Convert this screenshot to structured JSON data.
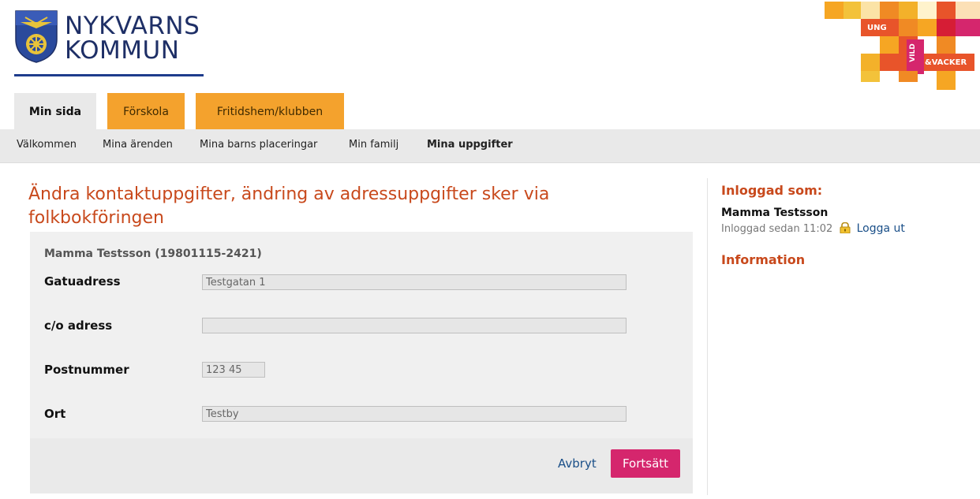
{
  "logo": {
    "line1": "NYKVARNS",
    "line2": "KOMMUN"
  },
  "brand": {
    "ung": "UNG",
    "vild": "VILD",
    "vacker": "&VACKER"
  },
  "tabs": [
    {
      "label": "Min sida"
    },
    {
      "label": "Förskola"
    },
    {
      "label": "Fritidshem/klubben"
    }
  ],
  "subnav": [
    {
      "label": "Välkommen"
    },
    {
      "label": "Mina ärenden"
    },
    {
      "label": "Mina barns placeringar"
    },
    {
      "label": "Min familj"
    },
    {
      "label": "Mina uppgifter"
    }
  ],
  "page": {
    "title": "Ändra kontaktuppgifter, ändring av adressuppgifter sker via folkbokföringen",
    "owner": "Mamma Testsson (19801115-2421)"
  },
  "form": {
    "street": {
      "label": "Gatuadress",
      "value": "Testgatan 1"
    },
    "co": {
      "label": "c/o adress",
      "value": ""
    },
    "postcode": {
      "label": "Postnummer",
      "value": "123 45"
    },
    "city": {
      "label": "Ort",
      "value": "Testby"
    }
  },
  "actions": {
    "cancel": "Avbryt",
    "continue": "Fortsätt"
  },
  "side": {
    "logged_in_heading": "Inloggad som:",
    "user_name": "Mamma Testsson",
    "logged_in_since": "Inloggad sedan 11:02",
    "logout": "Logga ut",
    "info_heading": "Information"
  },
  "colors": {
    "accent_orange": "#f4a22d",
    "heading_red": "#c8491c",
    "button_pink": "#d5266d",
    "link_blue": "#1a4f88",
    "logo_navy": "#1e2f66"
  }
}
